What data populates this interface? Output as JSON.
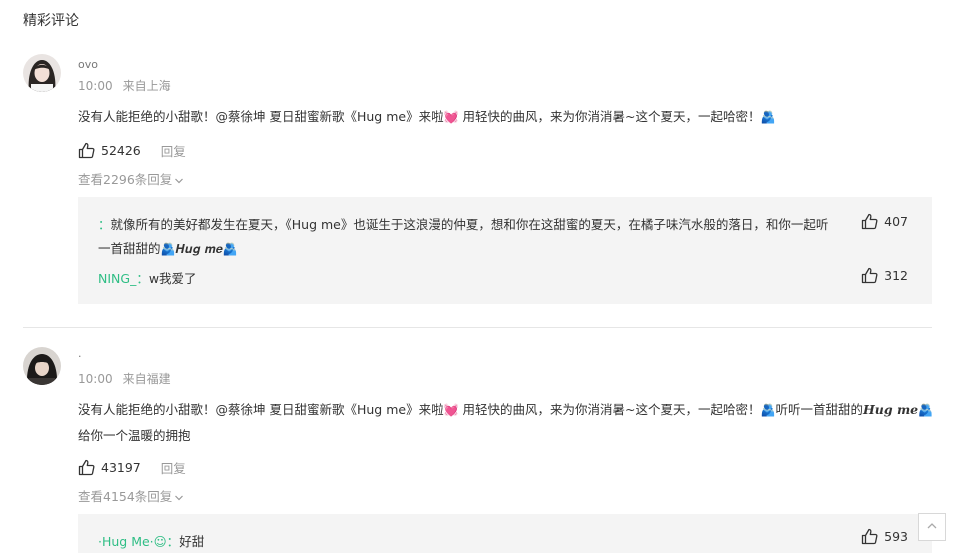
{
  "section_title": "精彩评论",
  "comments": [
    {
      "username": "ovo",
      "time": "10:00",
      "location": "来自上海",
      "text_a": "没有人能拒绝的小甜歌！@蔡徐坤 夏日甜蜜新歌《Hug me》来啦",
      "text_b": " 用轻快的曲风，来为你消消暑~这个夏天，一起哈密！",
      "emoji_heart": "💓",
      "emoji_hug": "🫂",
      "likes": "52426",
      "reply_label": "回复",
      "view_replies": "查看2296条回复",
      "replies": [
        {
          "user": "：",
          "text_a": "就像所有的美好都发生在夏天，《Hug me》也诞生于这浪漫的仲夏，想和你在这甜蜜的夏天，在橘子味汽水般的落日，和你一起听一首甜甜的",
          "hug_text": "𝑯𝒖𝒈 𝒎𝒆",
          "likes": "407"
        },
        {
          "user": "NING_：",
          "text_a": "w我爱了",
          "likes": "312"
        }
      ]
    },
    {
      "username": "·",
      "time": "10:00",
      "location": "来自福建",
      "text_a": "没有人能拒绝的小甜歌！@蔡徐坤 夏日甜蜜新歌《Hug me》来啦",
      "text_b": " 用轻快的曲风，来为你消消暑~这个夏天，一起哈密！",
      "text_c": "听听一首甜甜的",
      "hug_text": "𝑯𝒖𝒈 𝒎𝒆",
      "text_d": "给你一个温暖的拥抱",
      "likes": "43197",
      "reply_label": "回复",
      "view_replies": "查看4154条回复",
      "replies": [
        {
          "user": "·Hug Me·☺：",
          "text_a": "好甜",
          "likes": "593"
        }
      ]
    }
  ]
}
